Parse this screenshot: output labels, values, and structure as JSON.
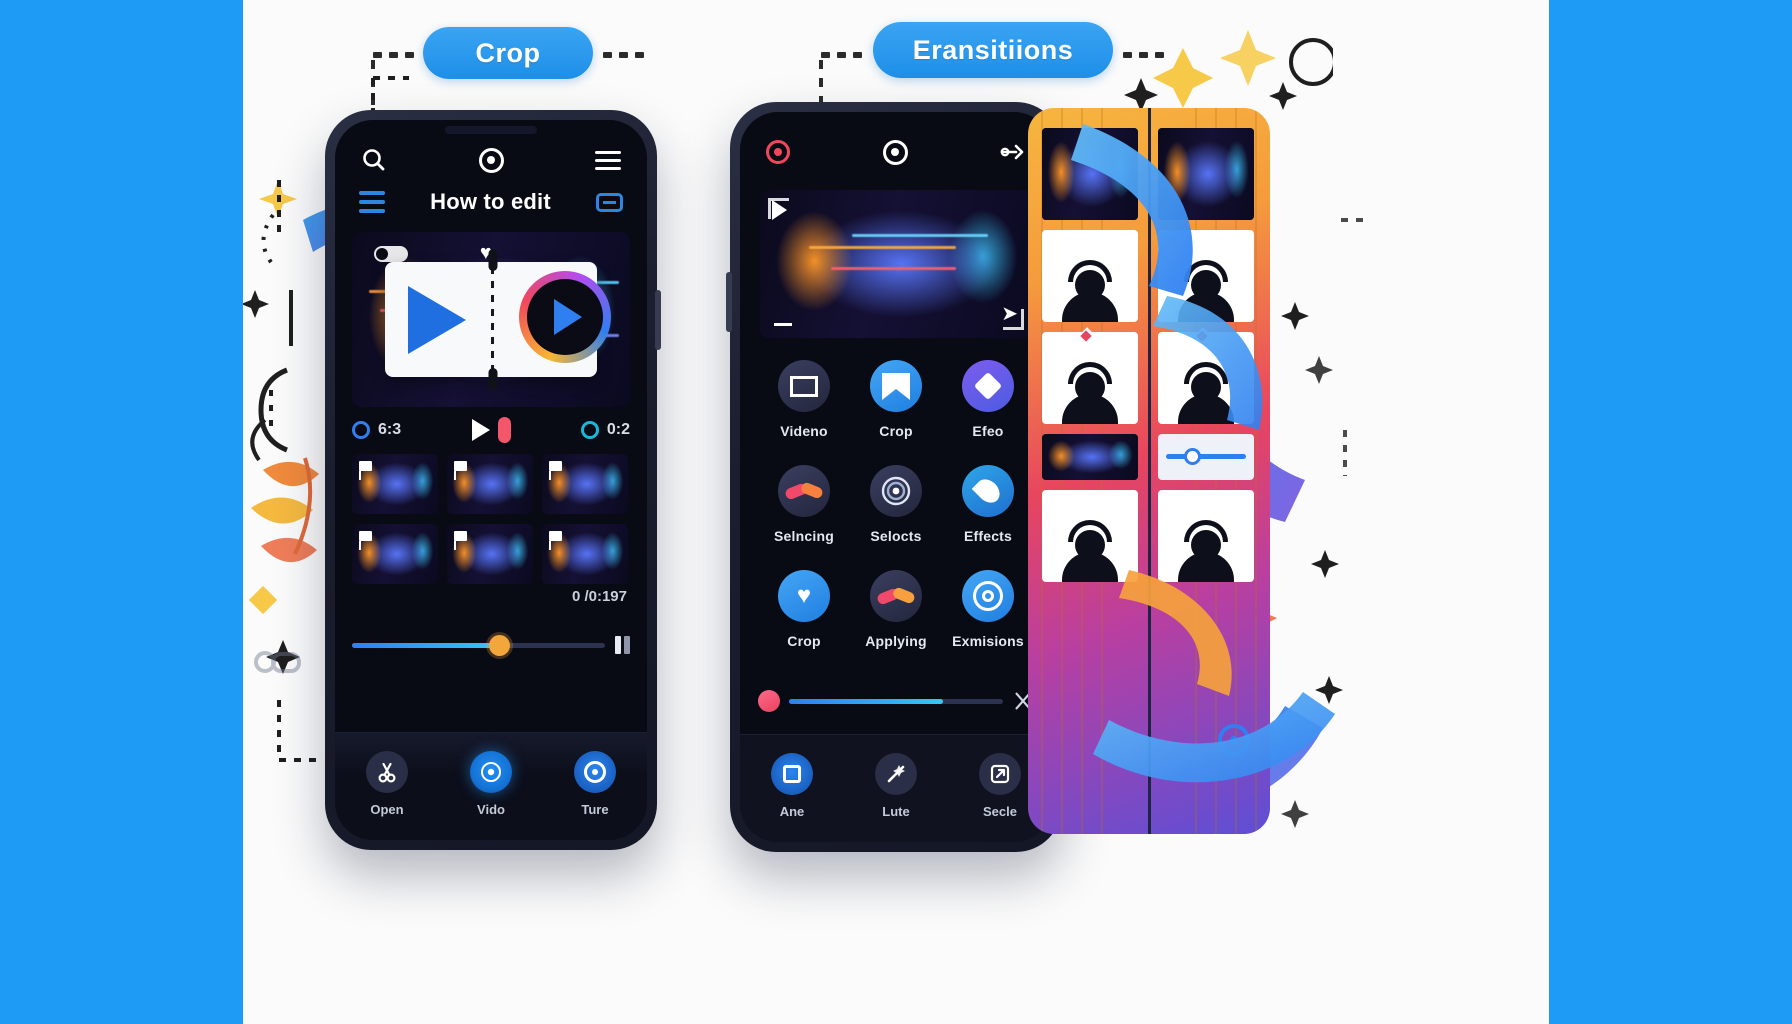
{
  "meta": {
    "background_color": "#1e9cf5",
    "canvas_color": "#fbfbfb",
    "accent_blue": "#2e86e0",
    "pill_blue": "#1d8fe8"
  },
  "callouts": [
    {
      "id": "crop",
      "label": "Crop"
    },
    {
      "id": "transitions",
      "label": "Eransitiions"
    }
  ],
  "phone1": {
    "statusbar": {
      "search_icon": "search-icon",
      "target_icon": "target-icon",
      "menu_icon": "menu-icon"
    },
    "header": {
      "menu_icon": "hamburger-icon",
      "title": "How to edit",
      "chip_icon": "caption-icon"
    },
    "preview": {
      "toggle_icon": "toggle-switch",
      "heart_icon": "heart-icon",
      "play_left_icon": "play-triangle-icon",
      "play_right_icon": "play-circle-icon"
    },
    "timecode": {
      "left_value": "6:3",
      "right_value": "0:2",
      "play_icon": "play-icon",
      "record_icon": "record-icon"
    },
    "thumbnails": {
      "rows": 2,
      "per_row": 3,
      "duration_overlay": "0 /0:197"
    },
    "scrubber": {
      "progress_percent": 58,
      "pause_icon": "pause-icon"
    },
    "nav": [
      {
        "label": "Open",
        "icon": "scissors-icon",
        "active": false
      },
      {
        "label": "Vido",
        "icon": "lens-icon",
        "active": true
      },
      {
        "label": "Ture",
        "icon": "ring-icon",
        "active": true
      }
    ]
  },
  "phone2": {
    "statusbar": {
      "record_icon": "record-icon",
      "target_icon": "target-icon",
      "link_icon": "link-icon"
    },
    "preview": {
      "play_icon": "play-icon",
      "minus_icon": "minus-icon",
      "plane_icon": "send-icon"
    },
    "grid": [
      [
        {
          "label": "Videno",
          "icon": "image-icon",
          "style": "dark"
        },
        {
          "label": "Crop",
          "icon": "bookmark-icon",
          "style": "blue"
        },
        {
          "label": "Efeo",
          "icon": "diamond-icon",
          "style": "purple"
        }
      ],
      [
        {
          "label": "Selncing",
          "icon": "tools-icon",
          "style": "dark"
        },
        {
          "label": "Selocts",
          "icon": "lens-icon",
          "style": "dark"
        },
        {
          "label": "Effects",
          "icon": "droplet-icon",
          "style": "cyan"
        }
      ],
      [
        {
          "label": "Crop",
          "icon": "heart-icon",
          "style": "blue"
        },
        {
          "label": "Applying",
          "icon": "tools-icon",
          "style": "dark"
        },
        {
          "label": "Exmisions",
          "icon": "target-icon",
          "style": "blue"
        }
      ]
    ],
    "scrubber": {
      "progress_percent": 72,
      "knob_icon": "scrub-knob",
      "end_icon": "cut-icon"
    },
    "nav": [
      {
        "label": "Ane",
        "icon": "square-icon",
        "active": true
      },
      {
        "label": "Lute",
        "icon": "wand-icon",
        "active": false
      },
      {
        "label": "Secle",
        "icon": "export-icon",
        "active": false
      }
    ]
  },
  "collage": {
    "description": "film-strip collage panel",
    "cells": 8,
    "person_icon": "headphones-person-icon"
  }
}
